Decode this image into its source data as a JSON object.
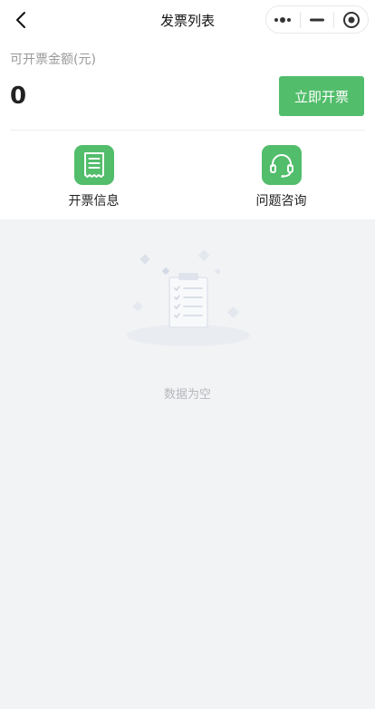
{
  "navbar": {
    "title": "发票列表",
    "back_icon": "chevron-left-icon",
    "capsule_icons": [
      "more-dots-icon",
      "minimize-icon",
      "close-circle-icon"
    ]
  },
  "amount": {
    "label": "可开票金额(元)",
    "value": "0",
    "issue_button_label": "立即开票"
  },
  "actions": [
    {
      "label": "开票信息",
      "icon": "receipt-icon"
    },
    {
      "label": "问题咨询",
      "icon": "headset-icon"
    }
  ],
  "empty": {
    "text": "数据为空",
    "icon": "empty-clipboard-icon"
  },
  "colors": {
    "accent": "#52bd6b",
    "background": "#f2f3f5",
    "empty_text": "#b5b8bd"
  }
}
